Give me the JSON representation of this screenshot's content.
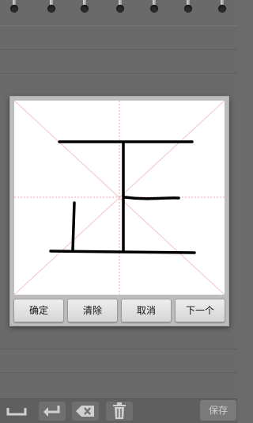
{
  "dialog": {
    "buttons": {
      "confirm": "确定",
      "clear": "清除",
      "cancel": "取消",
      "next": "下一个"
    }
  },
  "bottombar": {
    "save": "保存",
    "icons": [
      "space-icon",
      "enter-icon",
      "backspace-icon",
      "trash-icon"
    ]
  },
  "colors": {
    "background": "#6a6a6a",
    "dialog": "#bdbdbd",
    "grid": "#f2a6a6",
    "stroke": "#000000"
  }
}
